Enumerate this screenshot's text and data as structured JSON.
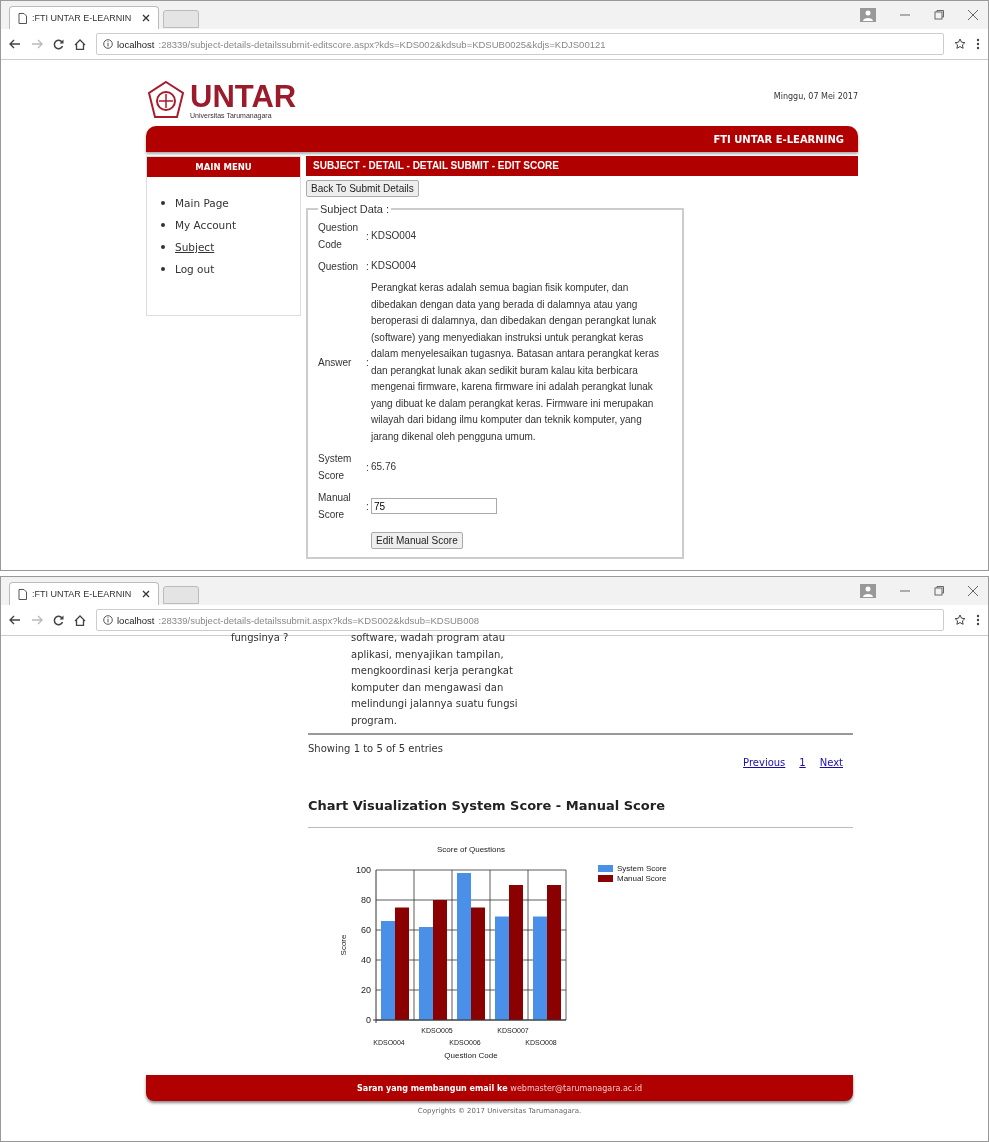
{
  "windows": [
    {
      "tab_title": ":FTI UNTAR E-LEARNIN",
      "url_host": "localhost",
      "url_rest": ":28339/subject-details-detailssubmit-editscore.aspx?kds=KDS002&kdsub=KDSUB0025&kdjs=KDJS00121",
      "page": {
        "kind": "edit",
        "logo_text": "UNTAR",
        "logo_subtitle": "Universitas Tarumanagara",
        "date": "Minggu, 07 Mei 2017",
        "banner": "FTI UNTAR E-LEARNING",
        "menu_title": "MAIN MENU",
        "menu_items": [
          {
            "label": "Main Page",
            "selected": false
          },
          {
            "label": "My Account",
            "selected": false
          },
          {
            "label": "Subject",
            "selected": true
          },
          {
            "label": "Log out",
            "selected": false
          }
        ],
        "content_title": "SUBJECT - DETAIL - DETAIL SUBMIT - EDIT SCORE",
        "back_button": "Back To Submit Details",
        "legend": "Subject Data :",
        "fields": [
          {
            "kind": "text",
            "label": "Question Code",
            "colon": ":",
            "value": "KDSO004"
          },
          {
            "kind": "text",
            "label": "Question",
            "colon": ":",
            "value": "KDSO004"
          },
          {
            "kind": "text",
            "label": "Answer",
            "colon": ":",
            "value": "Perangkat keras adalah semua bagian fisik komputer, dan dibedakan dengan data yang berada di dalamnya atau yang beroperasi di dalamnya, dan dibedakan dengan perangkat lunak (software) yang menyediakan instruksi untuk perangkat keras dalam menyelesaikan tugasnya. Batasan antara perangkat keras dan perangkat lunak akan sedikit buram kalau kita berbicara mengenai firmware, karena firmware ini adalah perangkat lunak yang dibuat ke dalam perangkat keras. Firmware ini merupakan wilayah dari bidang ilmu komputer dan teknik komputer, yang jarang dikenal oleh pengguna umum."
          },
          {
            "kind": "text",
            "label": "System Score",
            "colon": ":",
            "value": "65.76"
          },
          {
            "kind": "input",
            "label": "Manual Score",
            "colon": ":",
            "value": "75"
          }
        ],
        "submit_button": "Edit Manual Score"
      }
    },
    {
      "tab_title": ":FTI UNTAR E-LEARNIN",
      "url_host": "localhost",
      "url_rest": ":28339/subject-details-detailssubmit.aspx?kds=KDS002&kdsub=KDSUB008",
      "page": {
        "kind": "list",
        "question_cut": "fungsinya ?",
        "answer_cut": "software, wadah program atau aplikasi, menyajikan tampilan, mengkoordinasi kerja perangkat komputer dan mengawasi dan melindungi jalannya suatu fungsi program.",
        "entries_info": "Showing 1 to 5 of 5 entries",
        "pagination": [
          {
            "label": "Previous",
            "selected": false
          },
          {
            "label": "1",
            "selected": false
          },
          {
            "label": "Next",
            "selected": false
          }
        ],
        "chart_heading": "Chart Visualization System Score - Manual Score",
        "chart_data": {
          "type": "bar",
          "title": "Score of Questions",
          "xlabel": "Question Code",
          "ylabel": "Score",
          "categories": [
            "KDSO004",
            "KDSO005",
            "KDSO006",
            "KDSO007",
            "KDSO008"
          ],
          "series": [
            {
              "name": "System Score",
              "color": "#4a90e8",
              "values": [
                66,
                62,
                98,
                69,
                69
              ]
            },
            {
              "name": "Manual Score",
              "color": "#8b0000",
              "values": [
                75,
                80,
                75,
                90,
                90
              ]
            }
          ],
          "ylim": [
            0,
            100
          ],
          "yticks": [
            0,
            20,
            40,
            60,
            80,
            100
          ],
          "grid": true,
          "legend": true
        },
        "footer_text": "Saran yang membangun email ke ",
        "footer_link": "webmaster@tarumanagara.ac.id",
        "copyright": "Copyrights © 2017 Universitas Tarumanagara."
      }
    }
  ]
}
